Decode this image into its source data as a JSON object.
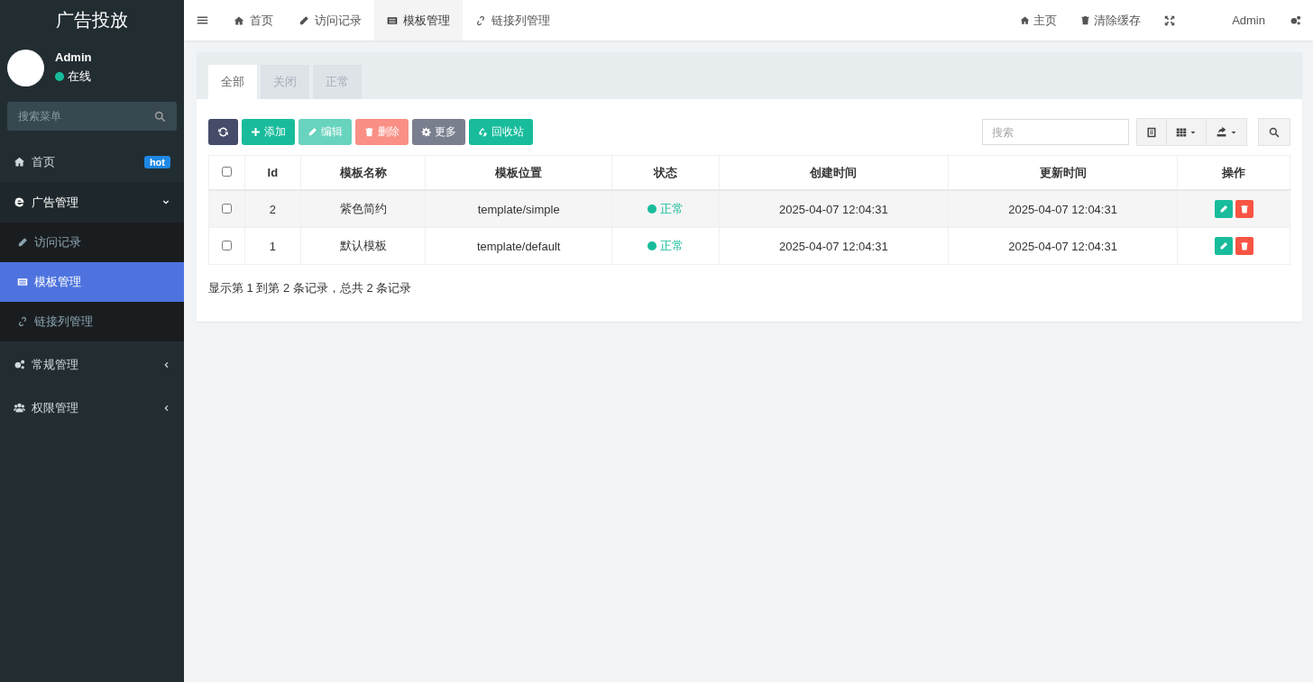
{
  "sidebar": {
    "logo": "广告投放",
    "user": {
      "name": "Admin",
      "status": "在线"
    },
    "search": {
      "placeholder": "搜索菜单"
    },
    "menu": [
      {
        "label": "首页",
        "kind": "home",
        "badge": "hot",
        "selected": false
      },
      {
        "label": "广告管理",
        "kind": "ie",
        "expanded": true,
        "selected": false,
        "children": [
          {
            "label": "访问记录",
            "kind": "pencil",
            "selected": false
          },
          {
            "label": "模板管理",
            "kind": "list",
            "selected": true
          },
          {
            "label": "链接列管理",
            "kind": "link",
            "selected": false
          }
        ]
      },
      {
        "label": "常规管理",
        "kind": "gears",
        "expanded": false,
        "selected": false
      },
      {
        "label": "权限管理",
        "kind": "users",
        "expanded": false,
        "selected": false
      }
    ]
  },
  "topbar": {
    "tabs": [
      {
        "label": "首页",
        "kind": "home",
        "selected": false
      },
      {
        "label": "访问记录",
        "kind": "pencil",
        "selected": false
      },
      {
        "label": "模板管理",
        "kind": "list",
        "selected": true
      },
      {
        "label": "链接列管理",
        "kind": "link",
        "selected": false
      }
    ],
    "links": [
      {
        "label": "主页",
        "kind": "home"
      },
      {
        "label": "清除缓存",
        "kind": "trash"
      }
    ],
    "user": "Admin"
  },
  "panel": {
    "filter_tabs": [
      {
        "label": "全部",
        "selected": true
      },
      {
        "label": "关闭",
        "selected": false
      },
      {
        "label": "正常",
        "selected": false
      }
    ],
    "buttons": [
      {
        "kind": "refresh",
        "disabled": false
      },
      {
        "kind": "add",
        "label": "添加",
        "disabled": false
      },
      {
        "kind": "edit",
        "label": "编辑",
        "disabled": true
      },
      {
        "kind": "delete",
        "label": "删除",
        "disabled": true
      },
      {
        "kind": "more",
        "label": "更多",
        "disabled": false
      },
      {
        "kind": "recycle",
        "label": "回收站",
        "disabled": false
      }
    ],
    "search": {
      "placeholder": "搜索"
    },
    "table": {
      "select_all": {
        "checked": false
      },
      "columns": [
        "Id",
        "模板名称",
        "模板位置",
        "状态",
        "创建时间",
        "更新时间",
        "操作"
      ],
      "rows": [
        {
          "checked": false,
          "id": "2",
          "name": "紫色简约",
          "location": "template/simple",
          "status": {
            "label": "正常",
            "color": "#18bc9c"
          },
          "created": "2025-04-07 12:04:31",
          "updated": "2025-04-07 12:04:31"
        },
        {
          "checked": false,
          "id": "1",
          "name": "默认模板",
          "location": "template/default",
          "status": {
            "label": "正常",
            "color": "#18bc9c"
          },
          "created": "2025-04-07 12:04:31",
          "updated": "2025-04-07 12:04:31"
        }
      ]
    },
    "footer": "显示第 1 到第 2 条记录，总共 2 条记录"
  }
}
